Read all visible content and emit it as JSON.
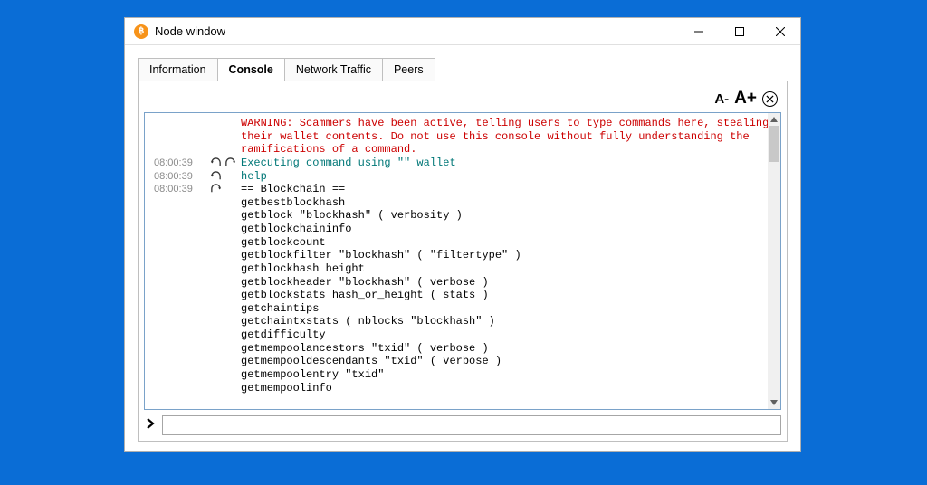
{
  "window": {
    "title": "Node window"
  },
  "tabs": {
    "information": "Information",
    "console": "Console",
    "network": "Network Traffic",
    "peers": "Peers"
  },
  "toolbar": {
    "font_minus": "A-",
    "font_plus": "A+"
  },
  "warning": "WARNING: Scammers have been active, telling users to type commands here, stealing\ntheir wallet contents. Do not use this console without fully understanding the\nramifications of a command.",
  "lines": {
    "l1": {
      "ts": "08:00:39",
      "text": "Executing command using \"\" wallet"
    },
    "l2": {
      "ts": "08:00:39",
      "text": "help"
    },
    "l3": {
      "ts": "08:00:39",
      "text": "== Blockchain ==\ngetbestblockhash\ngetblock \"blockhash\" ( verbosity )\ngetblockchaininfo\ngetblockcount\ngetblockfilter \"blockhash\" ( \"filtertype\" )\ngetblockhash height\ngetblockheader \"blockhash\" ( verbose )\ngetblockstats hash_or_height ( stats )\ngetchaintips\ngetchaintxstats ( nblocks \"blockhash\" )\ngetdifficulty\ngetmempoolancestors \"txid\" ( verbose )\ngetmempooldescendants \"txid\" ( verbose )\ngetmempoolentry \"txid\"\ngetmempoolinfo"
    }
  },
  "input": {
    "placeholder": ""
  }
}
